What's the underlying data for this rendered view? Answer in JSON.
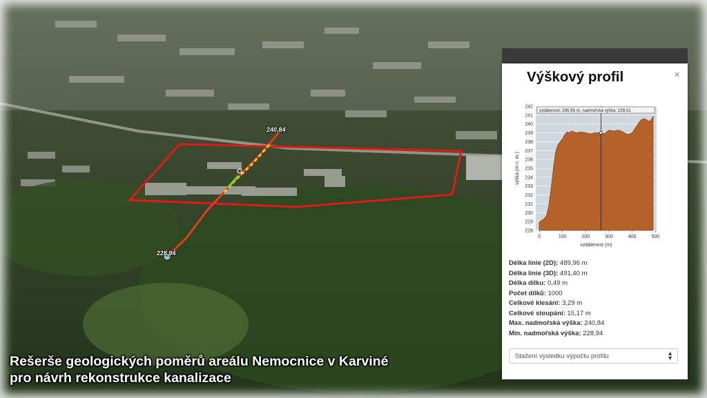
{
  "caption": {
    "line1": "Rešerše geologických poměrů areálu Nemocnice v Karviné",
    "line2": "pro návrh rekonstrukce kanalizace"
  },
  "map": {
    "start_label": "240,84",
    "end_label": "228,94"
  },
  "profile_panel": {
    "title": "Výškový profil",
    "close_icon": "close-icon",
    "chart_data": {
      "type": "area",
      "title": "",
      "xlabel": "vzdálenost (m)",
      "ylabel": "výška (m n. m.)",
      "xlim": [
        -15,
        505
      ],
      "ylim": [
        228,
        242
      ],
      "xticks": [
        0,
        100,
        200,
        300,
        400,
        500
      ],
      "yticks": [
        228,
        229,
        230,
        231,
        232,
        233,
        234,
        235,
        236,
        237,
        238,
        239,
        240,
        241,
        242
      ],
      "tooltip": "vzdálenost: 265,56 m, nadmořská výška: 239,01",
      "cursor_x": 265.56,
      "cursor_y": 239.01,
      "fill_color": "#b4622a",
      "x": [
        0,
        10,
        20,
        30,
        40,
        50,
        60,
        70,
        80,
        90,
        100,
        110,
        120,
        130,
        140,
        150,
        160,
        180,
        200,
        220,
        240,
        260,
        280,
        300,
        320,
        340,
        360,
        380,
        400,
        410,
        420,
        430,
        440,
        450,
        460,
        470,
        480,
        490
      ],
      "y": [
        228.94,
        229.1,
        229.3,
        229.6,
        230.6,
        232.5,
        234.8,
        236.8,
        237.6,
        238.0,
        238.3,
        238.8,
        239.1,
        239.0,
        239.2,
        239.1,
        239.0,
        239.1,
        239.0,
        238.9,
        239.0,
        239.0,
        238.9,
        239.3,
        239.2,
        239.3,
        239.1,
        238.8,
        239.0,
        239.4,
        239.8,
        240.2,
        240.5,
        240.6,
        240.5,
        240.3,
        240.4,
        240.84
      ]
    },
    "stats": [
      {
        "label": "Délka linie (2D):",
        "value": "489,96 m"
      },
      {
        "label": "Délka linie (3D):",
        "value": "491,40 m"
      },
      {
        "label": "Délka dílku:",
        "value": "0,49 m"
      },
      {
        "label": "Počet dílků:",
        "value": "1000"
      },
      {
        "label": "Celkové klesání:",
        "value": "3,29 m"
      },
      {
        "label": "Celkové stoupání:",
        "value": "15,17 m"
      },
      {
        "label": "Max. nadmořská výška:",
        "value": "240,84"
      },
      {
        "label": "Min. nadmořská výška:",
        "value": "228,94"
      }
    ],
    "download_select": "Stažení výsledku výpočtu profilu"
  }
}
